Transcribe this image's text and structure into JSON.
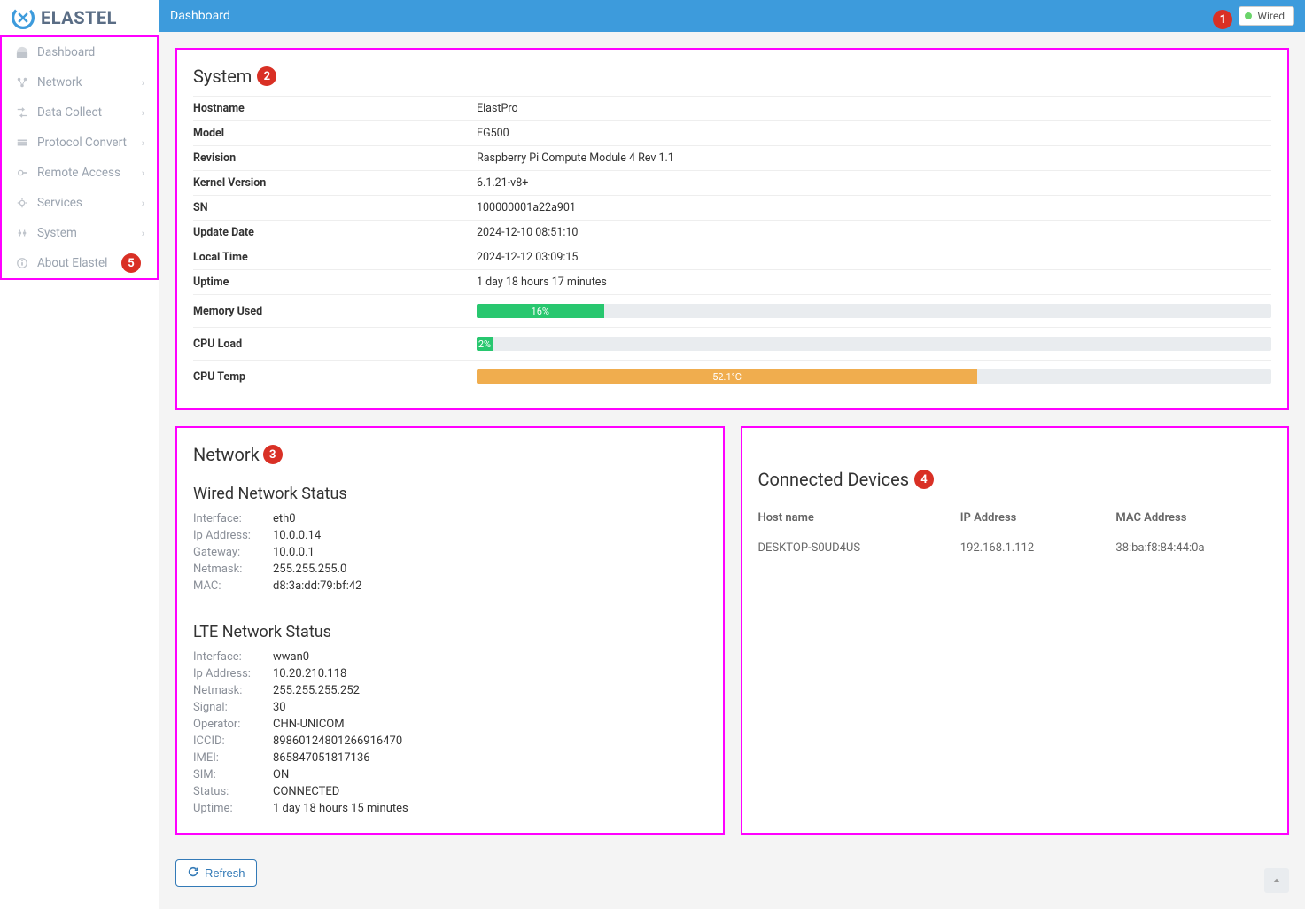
{
  "brand": "ELASTEL",
  "header": {
    "title": "Dashboard",
    "connection_label": "Wired"
  },
  "markers": {
    "topbar": "1",
    "system": "2",
    "network": "3",
    "devices": "4",
    "sidebar": "5"
  },
  "sidebar": {
    "items": [
      {
        "label": "Dashboard",
        "expandable": false
      },
      {
        "label": "Network",
        "expandable": true
      },
      {
        "label": "Data Collect",
        "expandable": true
      },
      {
        "label": "Protocol Convert",
        "expandable": true
      },
      {
        "label": "Remote Access",
        "expandable": true
      },
      {
        "label": "Services",
        "expandable": true
      },
      {
        "label": "System",
        "expandable": true
      },
      {
        "label": "About Elastel",
        "expandable": false
      }
    ]
  },
  "system_panel": {
    "title": "System",
    "rows": [
      {
        "key": "Hostname",
        "val": "ElastPro"
      },
      {
        "key": "Model",
        "val": "EG500"
      },
      {
        "key": "Revision",
        "val": "Raspberry Pi Compute Module 4 Rev 1.1"
      },
      {
        "key": "Kernel Version",
        "val": "6.1.21-v8+"
      },
      {
        "key": "SN",
        "val": "100000001a22a901"
      },
      {
        "key": "Update Date",
        "val": "2024-12-10 08:51:10"
      },
      {
        "key": "Local Time",
        "val": "2024-12-12 03:09:15"
      },
      {
        "key": "Uptime",
        "val": "1 day 18 hours 17 minutes"
      }
    ],
    "bars": [
      {
        "key": "Memory Used",
        "percent": 16,
        "label": "16%",
        "color": "green"
      },
      {
        "key": "CPU Load",
        "percent": 2,
        "label": "2%",
        "color": "green"
      },
      {
        "key": "CPU Temp",
        "percent": 63,
        "label": "52.1°C",
        "color": "orange"
      }
    ]
  },
  "network_panel": {
    "title": "Network",
    "wired": {
      "title": "Wired Network Status",
      "rows": [
        {
          "key": "Interface:",
          "val": "eth0"
        },
        {
          "key": "Ip Address:",
          "val": "10.0.0.14"
        },
        {
          "key": "Gateway:",
          "val": "10.0.0.1"
        },
        {
          "key": "Netmask:",
          "val": "255.255.255.0"
        },
        {
          "key": "MAC:",
          "val": "d8:3a:dd:79:bf:42"
        }
      ]
    },
    "lte": {
      "title": "LTE Network Status",
      "rows": [
        {
          "key": "Interface:",
          "val": "wwan0"
        },
        {
          "key": "Ip Address:",
          "val": "10.20.210.118"
        },
        {
          "key": "Netmask:",
          "val": "255.255.255.252"
        },
        {
          "key": "Signal:",
          "val": "30"
        },
        {
          "key": "Operator:",
          "val": "CHN-UNICOM"
        },
        {
          "key": "ICCID:",
          "val": "89860124801266916470"
        },
        {
          "key": "IMEI:",
          "val": "865847051817136"
        },
        {
          "key": "SIM:",
          "val": "ON"
        },
        {
          "key": "Status:",
          "val": "CONNECTED"
        },
        {
          "key": "Uptime:",
          "val": "1 day 18 hours 15 minutes"
        }
      ]
    }
  },
  "devices_panel": {
    "title": "Connected Devices",
    "columns": [
      "Host name",
      "IP Address",
      "MAC Address"
    ],
    "rows": [
      {
        "host": "DESKTOP-S0UD4US",
        "ip": "192.168.1.112",
        "mac": "38:ba:f8:84:44:0a"
      }
    ]
  },
  "refresh_label": "Refresh"
}
